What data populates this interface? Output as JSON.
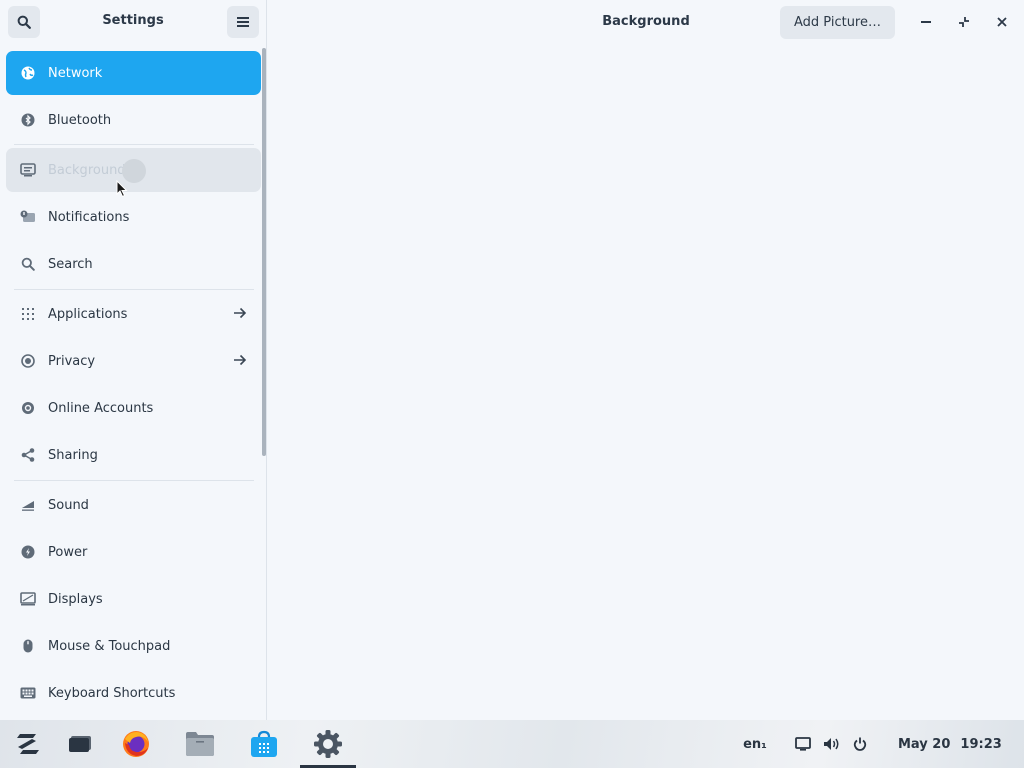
{
  "sidebar": {
    "title": "Settings",
    "items": [
      {
        "label": "Network",
        "icon": "globe-icon",
        "state": "active"
      },
      {
        "label": "Bluetooth",
        "icon": "bluetooth-icon"
      },
      {
        "label": "Background",
        "icon": "monitor-icon",
        "state": "hover"
      },
      {
        "label": "Notifications",
        "icon": "notification-icon"
      },
      {
        "label": "Search",
        "icon": "search-icon"
      },
      {
        "label": "Applications",
        "icon": "grid-icon",
        "arrow": true
      },
      {
        "label": "Privacy",
        "icon": "privacy-icon",
        "arrow": true
      },
      {
        "label": "Online Accounts",
        "icon": "at-icon"
      },
      {
        "label": "Sharing",
        "icon": "share-icon"
      },
      {
        "label": "Sound",
        "icon": "sound-icon"
      },
      {
        "label": "Power",
        "icon": "power-bolt-icon"
      },
      {
        "label": "Displays",
        "icon": "display-icon"
      },
      {
        "label": "Mouse & Touchpad",
        "icon": "mouse-icon"
      },
      {
        "label": "Keyboard Shortcuts",
        "icon": "keyboard-icon"
      }
    ]
  },
  "content": {
    "title": "Background",
    "add_picture_label": "Add Picture…"
  },
  "taskbar": {
    "apps": [
      "zorin-menu-icon",
      "workspace-icon",
      "firefox-icon",
      "files-icon",
      "software-store-icon",
      "settings-icon"
    ],
    "keyboard_layout": "en₁",
    "date": "May 20",
    "time": "19:23"
  },
  "colors": {
    "accent": "#1ea6f0",
    "background": "#f4f7fb",
    "text": "#223040"
  }
}
